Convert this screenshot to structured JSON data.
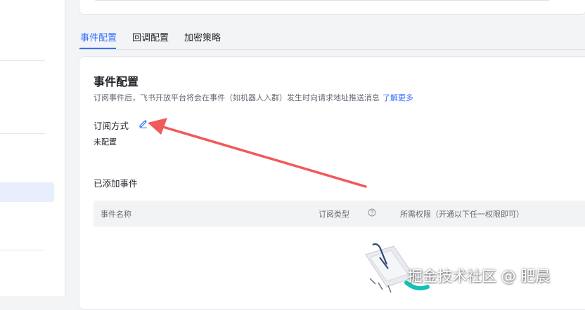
{
  "tabs": [
    {
      "label": "事件配置",
      "active": true
    },
    {
      "label": "回调配置",
      "active": false
    },
    {
      "label": "加密策略",
      "active": false
    }
  ],
  "section": {
    "title": "事件配置",
    "description": "订阅事件后，飞书开放平台将会在事件（如机器人入群）发生时向请求地址推送消息",
    "learn_more": "了解更多"
  },
  "subscription": {
    "label": "订阅方式",
    "status": "未配置",
    "edit_icon": "pencil-icon"
  },
  "added_events": {
    "title": "已添加事件",
    "columns": [
      "事件名称",
      "订阅类型",
      "所需权限（开通以下任一权限即可）"
    ],
    "help_icon": "question-circle-icon",
    "rows": []
  },
  "watermark": "掘金技术社区 @ 肥晨",
  "colors": {
    "accent": "#3370ff",
    "annotation_arrow": "#f05a5a"
  }
}
